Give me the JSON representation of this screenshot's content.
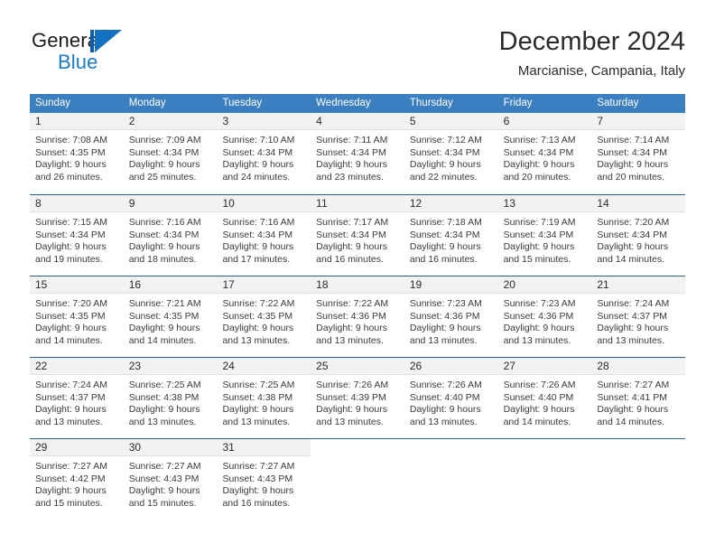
{
  "brand": {
    "name_part1": "General",
    "name_part2": "Blue",
    "logo_icon": "triangle-flag-icon",
    "accent_color": "#1471bf",
    "dark_accent_color": "#0e5ba6"
  },
  "header": {
    "title": "December 2024",
    "subtitle": "Marcianise, Campania, Italy"
  },
  "calendar": {
    "header_bg": "#3c7fc0",
    "row_divider_color": "#2c5f92",
    "day_band_bg": "#f2f2f2",
    "weekdays": [
      "Sunday",
      "Monday",
      "Tuesday",
      "Wednesday",
      "Thursday",
      "Friday",
      "Saturday"
    ],
    "weeks": [
      [
        {
          "day": "1",
          "lines": [
            "Sunrise: 7:08 AM",
            "Sunset: 4:35 PM",
            "Daylight: 9 hours",
            "and 26 minutes."
          ]
        },
        {
          "day": "2",
          "lines": [
            "Sunrise: 7:09 AM",
            "Sunset: 4:34 PM",
            "Daylight: 9 hours",
            "and 25 minutes."
          ]
        },
        {
          "day": "3",
          "lines": [
            "Sunrise: 7:10 AM",
            "Sunset: 4:34 PM",
            "Daylight: 9 hours",
            "and 24 minutes."
          ]
        },
        {
          "day": "4",
          "lines": [
            "Sunrise: 7:11 AM",
            "Sunset: 4:34 PM",
            "Daylight: 9 hours",
            "and 23 minutes."
          ]
        },
        {
          "day": "5",
          "lines": [
            "Sunrise: 7:12 AM",
            "Sunset: 4:34 PM",
            "Daylight: 9 hours",
            "and 22 minutes."
          ]
        },
        {
          "day": "6",
          "lines": [
            "Sunrise: 7:13 AM",
            "Sunset: 4:34 PM",
            "Daylight: 9 hours",
            "and 20 minutes."
          ]
        },
        {
          "day": "7",
          "lines": [
            "Sunrise: 7:14 AM",
            "Sunset: 4:34 PM",
            "Daylight: 9 hours",
            "and 20 minutes."
          ]
        }
      ],
      [
        {
          "day": "8",
          "lines": [
            "Sunrise: 7:15 AM",
            "Sunset: 4:34 PM",
            "Daylight: 9 hours",
            "and 19 minutes."
          ]
        },
        {
          "day": "9",
          "lines": [
            "Sunrise: 7:16 AM",
            "Sunset: 4:34 PM",
            "Daylight: 9 hours",
            "and 18 minutes."
          ]
        },
        {
          "day": "10",
          "lines": [
            "Sunrise: 7:16 AM",
            "Sunset: 4:34 PM",
            "Daylight: 9 hours",
            "and 17 minutes."
          ]
        },
        {
          "day": "11",
          "lines": [
            "Sunrise: 7:17 AM",
            "Sunset: 4:34 PM",
            "Daylight: 9 hours",
            "and 16 minutes."
          ]
        },
        {
          "day": "12",
          "lines": [
            "Sunrise: 7:18 AM",
            "Sunset: 4:34 PM",
            "Daylight: 9 hours",
            "and 16 minutes."
          ]
        },
        {
          "day": "13",
          "lines": [
            "Sunrise: 7:19 AM",
            "Sunset: 4:34 PM",
            "Daylight: 9 hours",
            "and 15 minutes."
          ]
        },
        {
          "day": "14",
          "lines": [
            "Sunrise: 7:20 AM",
            "Sunset: 4:34 PM",
            "Daylight: 9 hours",
            "and 14 minutes."
          ]
        }
      ],
      [
        {
          "day": "15",
          "lines": [
            "Sunrise: 7:20 AM",
            "Sunset: 4:35 PM",
            "Daylight: 9 hours",
            "and 14 minutes."
          ]
        },
        {
          "day": "16",
          "lines": [
            "Sunrise: 7:21 AM",
            "Sunset: 4:35 PM",
            "Daylight: 9 hours",
            "and 14 minutes."
          ]
        },
        {
          "day": "17",
          "lines": [
            "Sunrise: 7:22 AM",
            "Sunset: 4:35 PM",
            "Daylight: 9 hours",
            "and 13 minutes."
          ]
        },
        {
          "day": "18",
          "lines": [
            "Sunrise: 7:22 AM",
            "Sunset: 4:36 PM",
            "Daylight: 9 hours",
            "and 13 minutes."
          ]
        },
        {
          "day": "19",
          "lines": [
            "Sunrise: 7:23 AM",
            "Sunset: 4:36 PM",
            "Daylight: 9 hours",
            "and 13 minutes."
          ]
        },
        {
          "day": "20",
          "lines": [
            "Sunrise: 7:23 AM",
            "Sunset: 4:36 PM",
            "Daylight: 9 hours",
            "and 13 minutes."
          ]
        },
        {
          "day": "21",
          "lines": [
            "Sunrise: 7:24 AM",
            "Sunset: 4:37 PM",
            "Daylight: 9 hours",
            "and 13 minutes."
          ]
        }
      ],
      [
        {
          "day": "22",
          "lines": [
            "Sunrise: 7:24 AM",
            "Sunset: 4:37 PM",
            "Daylight: 9 hours",
            "and 13 minutes."
          ]
        },
        {
          "day": "23",
          "lines": [
            "Sunrise: 7:25 AM",
            "Sunset: 4:38 PM",
            "Daylight: 9 hours",
            "and 13 minutes."
          ]
        },
        {
          "day": "24",
          "lines": [
            "Sunrise: 7:25 AM",
            "Sunset: 4:38 PM",
            "Daylight: 9 hours",
            "and 13 minutes."
          ]
        },
        {
          "day": "25",
          "lines": [
            "Sunrise: 7:26 AM",
            "Sunset: 4:39 PM",
            "Daylight: 9 hours",
            "and 13 minutes."
          ]
        },
        {
          "day": "26",
          "lines": [
            "Sunrise: 7:26 AM",
            "Sunset: 4:40 PM",
            "Daylight: 9 hours",
            "and 13 minutes."
          ]
        },
        {
          "day": "27",
          "lines": [
            "Sunrise: 7:26 AM",
            "Sunset: 4:40 PM",
            "Daylight: 9 hours",
            "and 14 minutes."
          ]
        },
        {
          "day": "28",
          "lines": [
            "Sunrise: 7:27 AM",
            "Sunset: 4:41 PM",
            "Daylight: 9 hours",
            "and 14 minutes."
          ]
        }
      ],
      [
        {
          "day": "29",
          "lines": [
            "Sunrise: 7:27 AM",
            "Sunset: 4:42 PM",
            "Daylight: 9 hours",
            "and 15 minutes."
          ]
        },
        {
          "day": "30",
          "lines": [
            "Sunrise: 7:27 AM",
            "Sunset: 4:43 PM",
            "Daylight: 9 hours",
            "and 15 minutes."
          ]
        },
        {
          "day": "31",
          "lines": [
            "Sunrise: 7:27 AM",
            "Sunset: 4:43 PM",
            "Daylight: 9 hours",
            "and 16 minutes."
          ]
        },
        {
          "day": "",
          "lines": []
        },
        {
          "day": "",
          "lines": []
        },
        {
          "day": "",
          "lines": []
        },
        {
          "day": "",
          "lines": []
        }
      ]
    ]
  }
}
